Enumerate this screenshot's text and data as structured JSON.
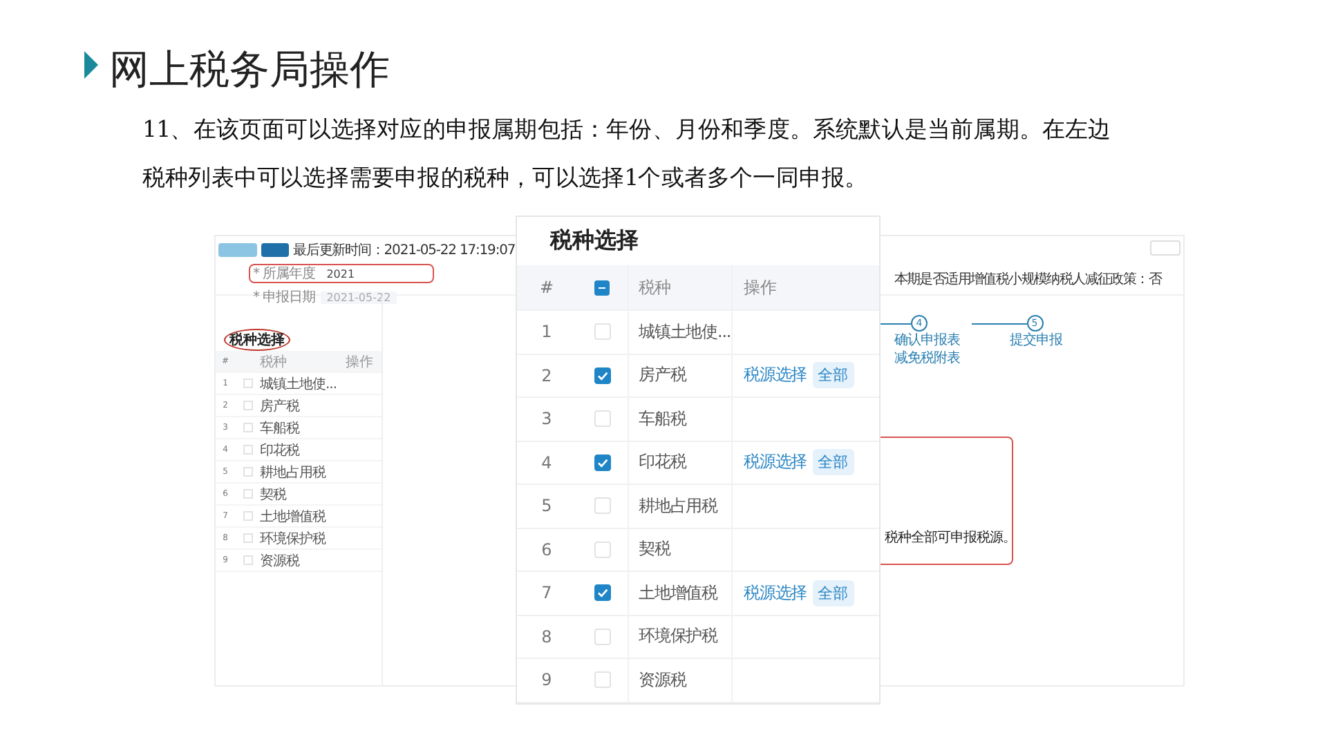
{
  "slide": {
    "title": "网上税务局操作",
    "lines": [
      "11、在该页面可以选择对应的申报属期包括：年份、月份和季度。系统默认是当前属期。在左边",
      "税种列表中可以选择需要申报的税种，可以选择1个或者多个一同申报。"
    ]
  },
  "screenshot": {
    "update_time": "最后更新时间：2021-05-22 17:19:07",
    "fields": [
      {
        "label": "* 所属年度",
        "value": "2021",
        "annotated": true,
        "disabled": false
      },
      {
        "label": "* 申报日期",
        "value": "2021-05-22",
        "annotated": false,
        "disabled": true
      }
    ],
    "notice": "本期是否适用增值税小规模纳税人减征政策：否",
    "side_table": {
      "title": "税种选择",
      "columns": [
        "#",
        "税种",
        "操作"
      ],
      "rows": [
        {
          "index": "1",
          "name": "城镇土地使...",
          "checked": false
        },
        {
          "index": "2",
          "name": "房产税",
          "checked": false
        },
        {
          "index": "3",
          "name": "车船税",
          "checked": false
        },
        {
          "index": "4",
          "name": "印花税",
          "checked": false
        },
        {
          "index": "5",
          "name": "耕地占用税",
          "checked": false
        },
        {
          "index": "6",
          "name": "契税",
          "checked": false
        },
        {
          "index": "7",
          "name": "土地增值税",
          "checked": false
        },
        {
          "index": "8",
          "name": "环境保护税",
          "checked": false
        },
        {
          "index": "9",
          "name": "资源税",
          "checked": false
        }
      ]
    },
    "steps": [
      {
        "number": "4",
        "label": "确认申报表",
        "sub": "减免税附表"
      },
      {
        "number": "5",
        "label": "提交申报"
      }
    ],
    "callout_text": "税种全部可申报税源。"
  },
  "popup": {
    "title": "税种选择",
    "columns": [
      "#",
      "税种",
      "操作"
    ],
    "header_checkbox": {
      "indeterminate": true
    },
    "rows": [
      {
        "index": "1",
        "name": "城镇土地使...",
        "checked": false
      },
      {
        "index": "2",
        "name": "房产税",
        "checked": true,
        "action": "税源选择",
        "tag": "全部"
      },
      {
        "index": "3",
        "name": "车船税",
        "checked": false
      },
      {
        "index": "4",
        "name": "印花税",
        "checked": true,
        "action": "税源选择",
        "tag": "全部"
      },
      {
        "index": "5",
        "name": "耕地占用税",
        "checked": false
      },
      {
        "index": "6",
        "name": "契税",
        "checked": false
      },
      {
        "index": "7",
        "name": "土地增值税",
        "checked": true,
        "action": "税源选择",
        "tag": "全部"
      },
      {
        "index": "8",
        "name": "环境保护税",
        "checked": false
      },
      {
        "index": "9",
        "name": "资源税",
        "checked": false
      }
    ]
  }
}
